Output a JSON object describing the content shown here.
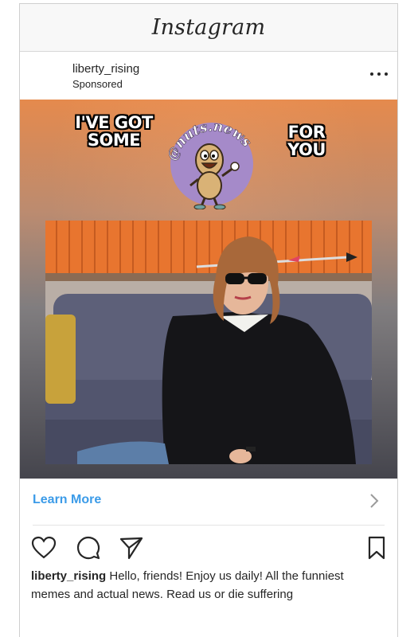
{
  "header": {
    "title": "Instagram"
  },
  "post": {
    "username": "liberty_rising",
    "label": "Sponsored",
    "more_icon": "ellipsis-icon"
  },
  "meme": {
    "left_text": "I'VE GOT SOME",
    "right_text": "FOR YOU",
    "logo_text": "@nuts.news",
    "logo_color": "#a58ac9"
  },
  "cta": {
    "label": "Learn More",
    "color": "#3b9be8"
  },
  "actions": {
    "like_icon": "heart-icon",
    "comment_icon": "comment-icon",
    "share_icon": "send-icon",
    "save_icon": "bookmark-icon"
  },
  "caption": {
    "username": "liberty_rising",
    "text": "Hello, friends! Enjoy us daily! All the funniest memes and actual news. Read us or die suffering"
  }
}
